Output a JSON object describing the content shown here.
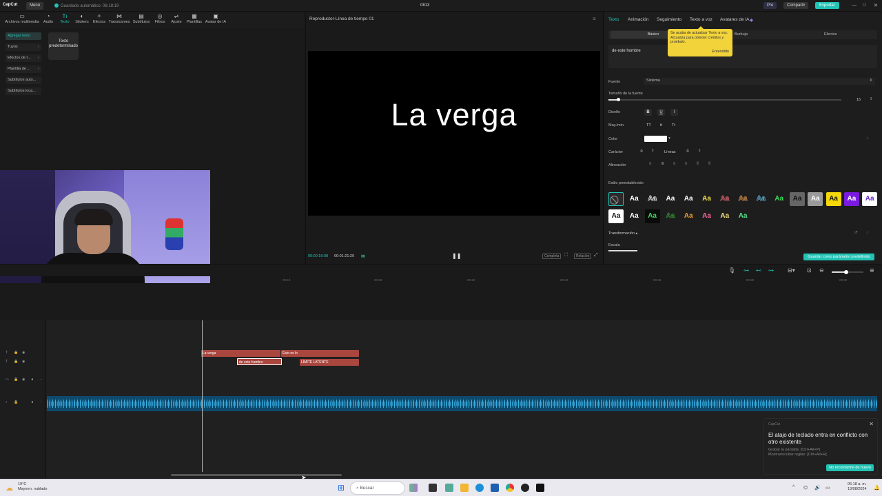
{
  "titlebar": {
    "app_name": "CapCut",
    "menu_label": "Menú",
    "autosave": "Guardado automático: 06:18:19",
    "project_name": "0813",
    "pro_label": "Pro",
    "share_label": "Compartir",
    "export_label": "Exportar",
    "minimize": "—",
    "maximize": "□",
    "close": "✕"
  },
  "toolbar": {
    "items": [
      {
        "label": "Archivos multimedia",
        "icon": "media-icon"
      },
      {
        "label": "Audio",
        "icon": "audio-icon"
      },
      {
        "label": "Texto",
        "icon": "text-icon",
        "active": true
      },
      {
        "label": "Stickers",
        "icon": "sticker-icon"
      },
      {
        "label": "Efectos",
        "icon": "effects-icon"
      },
      {
        "label": "Transiciones",
        "icon": "transition-icon"
      },
      {
        "label": "Subtítulos",
        "icon": "subtitle-icon"
      },
      {
        "label": "Filtros",
        "icon": "filter-icon"
      },
      {
        "label": "Ajuste",
        "icon": "adjust-icon"
      },
      {
        "label": "Plantillas",
        "icon": "template-icon"
      },
      {
        "label": "Avatar de IA",
        "icon": "avatar-icon"
      }
    ]
  },
  "sidebar": {
    "items": [
      {
        "label": "Agregar texto"
      },
      {
        "label": "Tuyos"
      },
      {
        "label": "Efectos de t..."
      },
      {
        "label": "Plantilla de ..."
      },
      {
        "label": "Subtítulos auto..."
      },
      {
        "label": "Subtítulos loca..."
      }
    ],
    "card_label": "Texto predeterminado"
  },
  "player": {
    "title": "Reproductor-Línea de tiempo 01",
    "caption": "La verga",
    "current_time": "00:00:16:08",
    "total_time": "00:01:21:29",
    "btn_completa": "Completa",
    "btn_ratio": "Relación"
  },
  "inspector": {
    "tabs": [
      "Texto",
      "Animación",
      "Seguimiento",
      "Texto a voz",
      "Avatares de IA"
    ],
    "subtabs": [
      "Básico",
      "Burbuja",
      "Efectos"
    ],
    "tooltip_text": "Se acaba de actualizar Texto a voz. Actualiza para obtener créditos y pruébalo.",
    "tooltip_ok": "Entendido",
    "text_value": "de este hombre",
    "font_label": "Fuente",
    "font_value": "Sistema",
    "font_size_label": "Tamaño de la fuente",
    "font_size_value": "15",
    "font_size_fraction": 0.04,
    "design_label": "Diseño",
    "bold": "B",
    "underline": "U",
    "italic": "I",
    "case_label": "May./min.",
    "case_opts": [
      "TT",
      "tt",
      "Tt"
    ],
    "color_label": "Color",
    "color_value": "#ffffff",
    "char_label": "Carácter",
    "char_value": "0",
    "lines_label": "Líneas",
    "lines_value": "0",
    "align_label": "Alineación",
    "preset_label": "Estilo preestablecido",
    "preset_sample": "Aa",
    "transform_label": "Transformación",
    "scale_label": "Escala",
    "save_preset": "Guardar como parámetro predefinido"
  },
  "timeline": {
    "ticks": [
      "00:18",
      "00:20",
      "00:22",
      "00:24",
      "00:26",
      "00:28",
      "00:30"
    ],
    "clips_row1": [
      "La verga",
      "Esto es lo"
    ],
    "clips_row2": [
      "de este hombre",
      "LÍMITE LATENTE"
    ]
  },
  "notification": {
    "app": "CapCut",
    "title": "El atajo de teclado entra en conflicto con otro existente",
    "line1": "Grabar la pantalla: [Ctrl+Alt+P]",
    "line2": "Mostrar/ocultar reglas: [Ctrl+Alt+R]",
    "button": "No recordarme de nuevo"
  },
  "taskbar": {
    "temp": "19°C",
    "weather": "Mayorm. nublado",
    "search": "Buscar",
    "time": "06:18 a. m.",
    "date": "13/08/2024"
  },
  "colors": {
    "accent": "#22c3b5",
    "clip_red": "#a9473f",
    "tooltip": "#f2d33a"
  }
}
